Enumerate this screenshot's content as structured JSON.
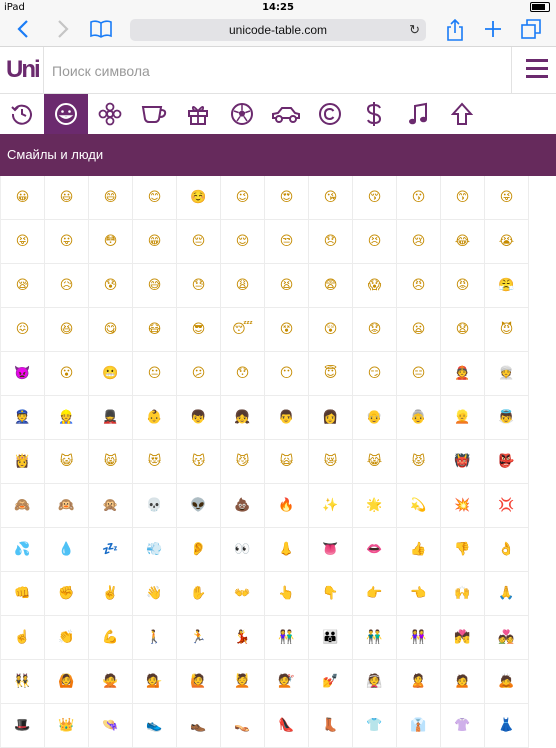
{
  "status": {
    "device": "iPad",
    "time": "14:25"
  },
  "browser": {
    "url": "unicode-table.com"
  },
  "search": {
    "placeholder": "Поиск символа"
  },
  "logo": {
    "text": "Uni"
  },
  "tabs": [
    {
      "icon": "history-icon",
      "glyph": "◷"
    },
    {
      "icon": "smiley-icon",
      "glyph": "☺"
    },
    {
      "icon": "flower-icon",
      "glyph": "✿"
    },
    {
      "icon": "cup-icon",
      "glyph": "☕"
    },
    {
      "icon": "gift-icon",
      "glyph": "🎁"
    },
    {
      "icon": "ball-icon",
      "glyph": "⚽"
    },
    {
      "icon": "car-icon",
      "glyph": "🚗"
    },
    {
      "icon": "copyright-icon",
      "glyph": "©"
    },
    {
      "icon": "dollar-icon",
      "glyph": "$"
    },
    {
      "icon": "music-note-icon",
      "glyph": "♫"
    },
    {
      "icon": "arrow-up-icon",
      "glyph": "⇧"
    }
  ],
  "section_title": "Смайлы и люди",
  "emoji_rows": [
    [
      "😀",
      "😃",
      "😄",
      "😊",
      "☺️",
      "😉",
      "😍",
      "😘",
      "😚",
      "😗",
      "😙",
      "😜"
    ],
    [
      "😝",
      "😛",
      "😳",
      "😁",
      "😔",
      "😌",
      "😒",
      "😞",
      "😣",
      "😢",
      "😂",
      "😭"
    ],
    [
      "😪",
      "😥",
      "😰",
      "😅",
      "😓",
      "😩",
      "😫",
      "😨",
      "😱",
      "😠",
      "😡",
      "😤"
    ],
    [
      "😖",
      "😆",
      "😋",
      "😷",
      "😎",
      "😴",
      "😵",
      "😲",
      "😟",
      "😦",
      "😧",
      "😈"
    ],
    [
      "👿",
      "😮",
      "😬",
      "😐",
      "😕",
      "😯",
      "😶",
      "😇",
      "😏",
      "😑",
      "👲",
      "👳"
    ],
    [
      "👮",
      "👷",
      "💂",
      "👶",
      "👦",
      "👧",
      "👨",
      "👩",
      "👴",
      "👵",
      "👱",
      "👼"
    ],
    [
      "👸",
      "😺",
      "😸",
      "😻",
      "😽",
      "😼",
      "🙀",
      "😿",
      "😹",
      "😾",
      "👹",
      "👺"
    ],
    [
      "🙈",
      "🙉",
      "🙊",
      "💀",
      "👽",
      "💩",
      "🔥",
      "✨",
      "🌟",
      "💫",
      "💥",
      "💢"
    ],
    [
      "💦",
      "💧",
      "💤",
      "💨",
      "👂",
      "👀",
      "👃",
      "👅",
      "👄",
      "👍",
      "👎",
      "👌"
    ],
    [
      "👊",
      "✊",
      "✌️",
      "👋",
      "✋",
      "👐",
      "👆",
      "👇",
      "👉",
      "👈",
      "🙌",
      "🙏"
    ],
    [
      "☝️",
      "👏",
      "💪",
      "🚶",
      "🏃",
      "💃",
      "👫",
      "👪",
      "👬",
      "👭",
      "💏",
      "💑"
    ],
    [
      "👯",
      "🙆",
      "🙅",
      "💁",
      "🙋",
      "💆",
      "💇",
      "💅",
      "👰",
      "🙎",
      "🙍",
      "🙇"
    ],
    [
      "🎩",
      "👑",
      "👒",
      "👟",
      "👞",
      "👡",
      "👠",
      "👢",
      "👕",
      "👔",
      "👚",
      "👗"
    ]
  ]
}
